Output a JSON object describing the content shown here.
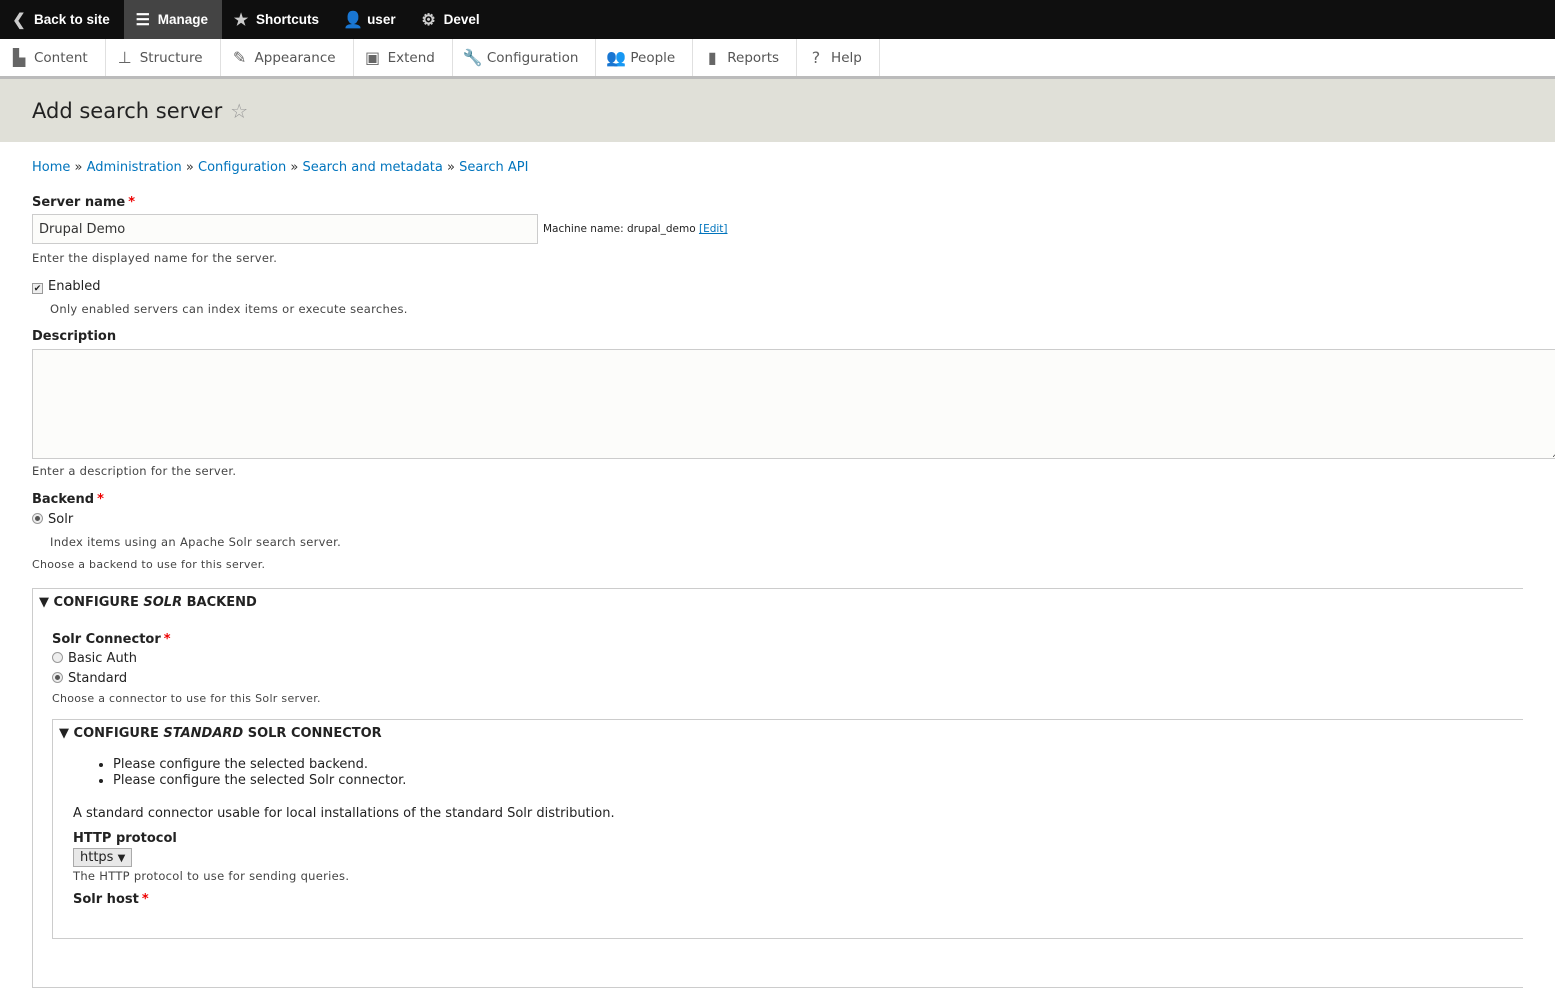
{
  "toolbar": {
    "items": [
      {
        "label": "Back to site",
        "icon": "back-icon"
      },
      {
        "label": "Manage",
        "icon": "menu-icon"
      },
      {
        "label": "Shortcuts",
        "icon": "star-icon"
      },
      {
        "label": "user",
        "icon": "user-icon"
      },
      {
        "label": "Devel",
        "icon": "gear-icon"
      }
    ]
  },
  "tray": {
    "items": [
      {
        "label": "Content"
      },
      {
        "label": "Structure"
      },
      {
        "label": "Appearance"
      },
      {
        "label": "Extend"
      },
      {
        "label": "Configuration"
      },
      {
        "label": "People"
      },
      {
        "label": "Reports"
      },
      {
        "label": "Help"
      }
    ]
  },
  "page": {
    "title": "Add search server"
  },
  "breadcrumb": [
    "Home",
    "Administration",
    "Configuration",
    "Search and metadata",
    "Search API"
  ],
  "breadcrumb_sep": "»",
  "form": {
    "server_name": {
      "label": "Server name",
      "value": "Drupal Demo",
      "machine_label": "Machine name: drupal_demo",
      "edit": "[Edit]",
      "desc": "Enter the displayed name for the server."
    },
    "enabled": {
      "label": "Enabled",
      "checked": true,
      "desc": "Only enabled servers can index items or execute searches."
    },
    "description": {
      "label": "Description",
      "value": "",
      "desc": "Enter a description for the server."
    },
    "backend": {
      "label": "Backend",
      "option": "Solr",
      "option_desc": "Index items using an Apache Solr search server.",
      "desc": "Choose a backend to use for this server."
    },
    "configure_backend": {
      "pre": "CONFIGURE ",
      "em": "SOLR",
      "post": " BACKEND"
    },
    "connector": {
      "label": "Solr Connector",
      "options": [
        {
          "label": "Basic Auth",
          "selected": false
        },
        {
          "label": "Standard",
          "selected": true
        }
      ],
      "desc": "Choose a connector to use for this Solr server."
    },
    "configure_connector": {
      "pre": "CONFIGURE ",
      "em": "STANDARD",
      "post": " SOLR CONNECTOR"
    },
    "messages": [
      "Please configure the selected backend.",
      "Please configure the selected Solr connector."
    ],
    "connector_desc": "A standard connector usable for local installations of the standard Solr distribution.",
    "http_protocol": {
      "label": "HTTP protocol",
      "value": "https",
      "desc": "The HTTP protocol to use for sending queries."
    },
    "solr_host": {
      "label": "Solr host"
    }
  },
  "required_mark": "*"
}
